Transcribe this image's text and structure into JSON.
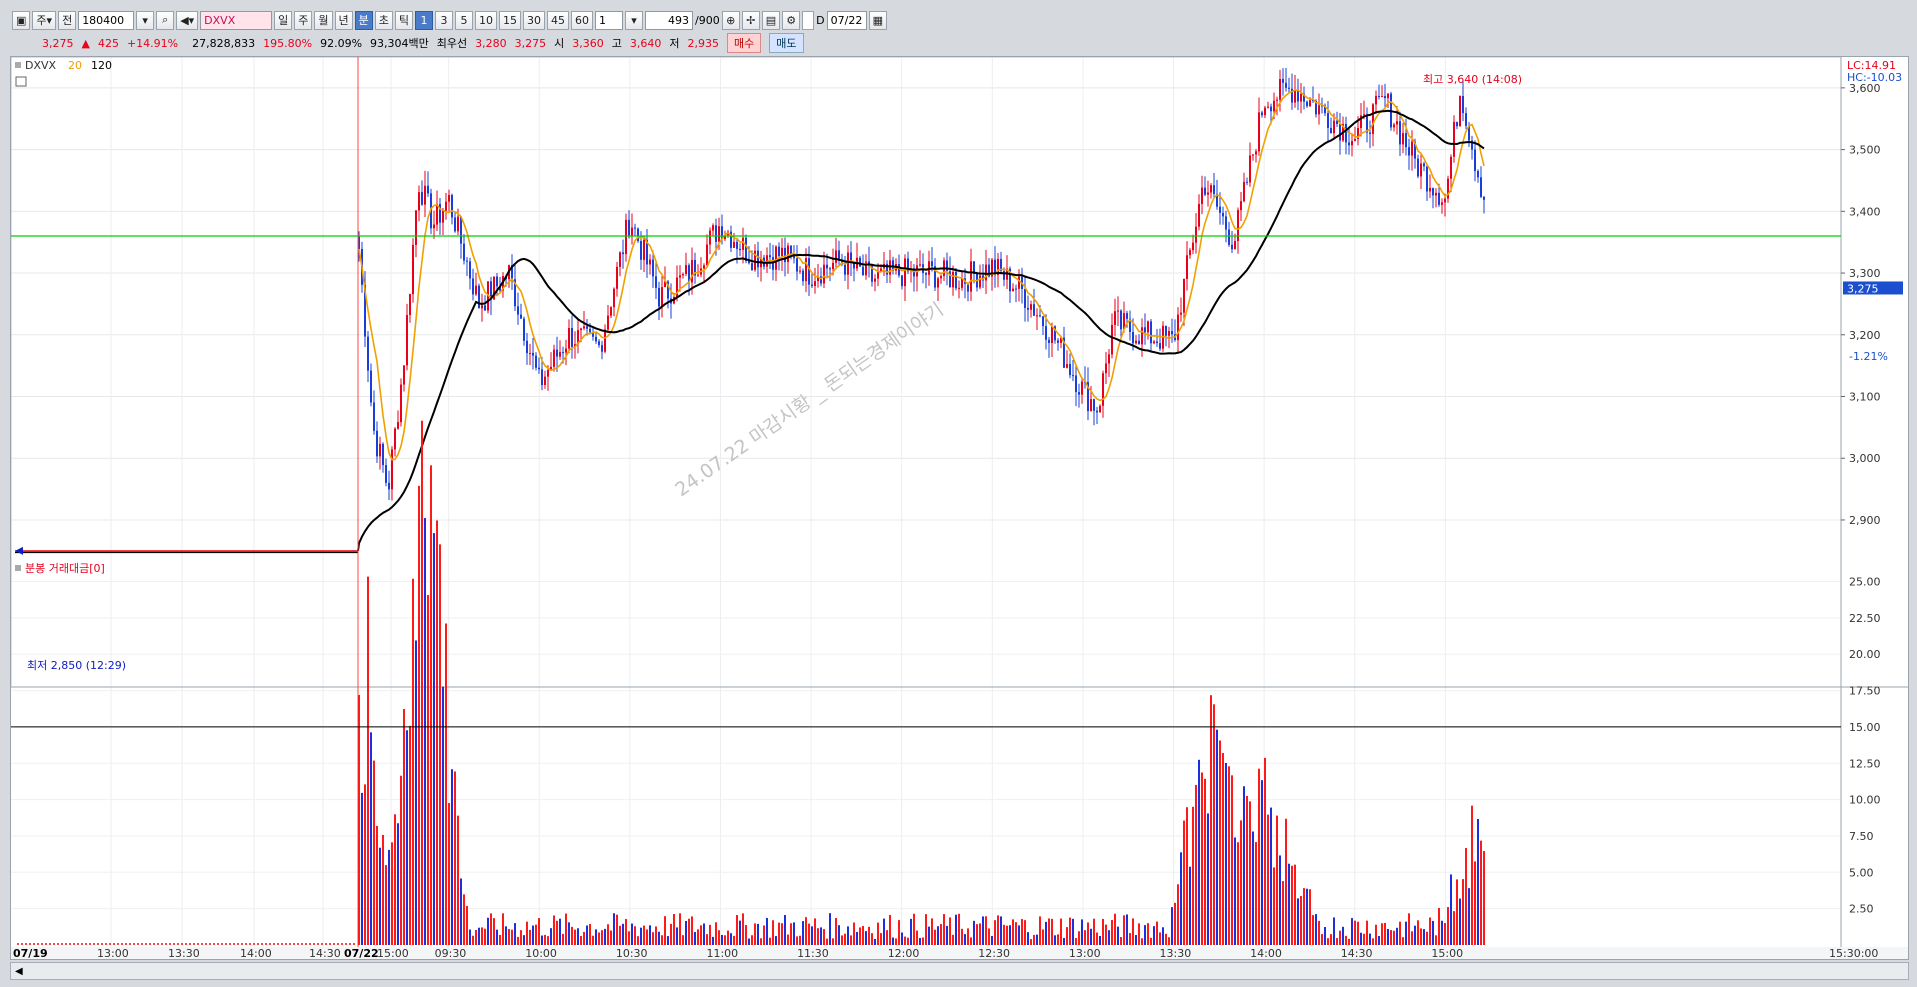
{
  "toolbar": {
    "market_type": "주",
    "view_mode": "전",
    "stock_code": "180400",
    "ticker": "DXVX",
    "periods": [
      "일",
      "주",
      "월",
      "년",
      "분",
      "초",
      "틱"
    ],
    "active_period": "분",
    "intervals": [
      "1",
      "3",
      "5",
      "10",
      "15",
      "30",
      "45",
      "60"
    ],
    "active_interval": "1",
    "interval_select": "1",
    "count": "493",
    "count_total": "/900",
    "checkbox_label": "D",
    "date": "07/22"
  },
  "infobar": {
    "price": "3,275",
    "change_arrow": "▲",
    "change": "425",
    "change_pct": "+14.91%",
    "volume": "27,828,833",
    "volume_ratio": "195.80%",
    "ratio2": "92.09%",
    "trade_value": "93,304백만",
    "best_label": "최우선",
    "ask": "3,280",
    "bid": "3,275",
    "open_label": "시",
    "open": "3,360",
    "high_label": "고",
    "high": "3,640",
    "low_label": "저",
    "low": "2,935",
    "buy_label": "매수",
    "sell_label": "매도"
  },
  "legend": {
    "ticker": "DXVX",
    "ma_short": "20",
    "ma_long": "120",
    "ma_short_color": "#f0a000",
    "ma_long_color": "#000000"
  },
  "right_axis": {
    "lc": "LC:14.91",
    "hc": "HC:-10.03",
    "current_price": "3,275",
    "current_pct": "-1.21%"
  },
  "annotations": {
    "high": "최고 3,640 (14:08)",
    "low": "최저 2,850 (12:29)",
    "watermark": "24.07.22 마감시황 _ 돈되는경제이야기"
  },
  "volume_panel": {
    "title": "분봉 거래대금[0]",
    "y_ticks": [
      "25.00",
      "22.50",
      "20.00",
      "17.50",
      "15.00",
      "12.50",
      "10.00",
      "7.50",
      "5.00",
      "2.50"
    ]
  },
  "time_axis": [
    "07/19",
    "13:00",
    "13:30",
    "14:00",
    "14:30",
    "15:00",
    "07/22",
    "09:30",
    "10:00",
    "10:30",
    "11:00",
    "11:30",
    "12:00",
    "12:30",
    "13:00",
    "13:30",
    "14:00",
    "14:30",
    "15:00",
    "15:30:00"
  ],
  "chart_data": {
    "type": "candlestick",
    "y_ticks": [
      "3,600",
      "3,500",
      "3,400",
      "3,300",
      "3,200",
      "3,100",
      "3,000",
      "2,900"
    ],
    "ylim": [
      2840,
      3650
    ],
    "reference_line": 3360,
    "previous_close_level": 2850,
    "high": {
      "value": 3640,
      "time": "14:08"
    },
    "low": {
      "value": 2850,
      "time": "12:29"
    },
    "close_series_approx": [
      {
        "t": "09:00",
        "v": 3360
      },
      {
        "t": "09:05",
        "v": 3050
      },
      {
        "t": "09:10",
        "v": 2950
      },
      {
        "t": "09:15",
        "v": 3150
      },
      {
        "t": "09:20",
        "v": 3450
      },
      {
        "t": "09:25",
        "v": 3380
      },
      {
        "t": "09:30",
        "v": 3420
      },
      {
        "t": "09:40",
        "v": 3250
      },
      {
        "t": "09:50",
        "v": 3300
      },
      {
        "t": "10:00",
        "v": 3120
      },
      {
        "t": "10:10",
        "v": 3200
      },
      {
        "t": "10:20",
        "v": 3180
      },
      {
        "t": "10:30",
        "v": 3390
      },
      {
        "t": "10:40",
        "v": 3260
      },
      {
        "t": "10:50",
        "v": 3300
      },
      {
        "t": "11:00",
        "v": 3380
      },
      {
        "t": "11:10",
        "v": 3330
      },
      {
        "t": "11:20",
        "v": 3330
      },
      {
        "t": "11:30",
        "v": 3300
      },
      {
        "t": "11:40",
        "v": 3320
      },
      {
        "t": "11:50",
        "v": 3290
      },
      {
        "t": "12:00",
        "v": 3300
      },
      {
        "t": "12:10",
        "v": 3300
      },
      {
        "t": "12:20",
        "v": 3290
      },
      {
        "t": "12:30",
        "v": 3310
      },
      {
        "t": "12:40",
        "v": 3270
      },
      {
        "t": "12:50",
        "v": 3200
      },
      {
        "t": "13:00",
        "v": 3110
      },
      {
        "t": "13:05",
        "v": 3080
      },
      {
        "t": "13:10",
        "v": 3220
      },
      {
        "t": "13:20",
        "v": 3200
      },
      {
        "t": "13:30",
        "v": 3190
      },
      {
        "t": "13:40",
        "v": 3450
      },
      {
        "t": "13:50",
        "v": 3350
      },
      {
        "t": "14:00",
        "v": 3580
      },
      {
        "t": "14:10",
        "v": 3600
      },
      {
        "t": "14:20",
        "v": 3560
      },
      {
        "t": "14:30",
        "v": 3520
      },
      {
        "t": "14:40",
        "v": 3580
      },
      {
        "t": "14:50",
        "v": 3480
      },
      {
        "t": "15:00",
        "v": 3420
      },
      {
        "t": "15:05",
        "v": 3600
      },
      {
        "t": "15:10",
        "v": 3480
      },
      {
        "t": "15:20",
        "v": 3275
      }
    ],
    "volume_spikes_approx": [
      {
        "t": "09:00",
        "v": 20.0
      },
      {
        "t": "09:22",
        "v": 25.0
      },
      {
        "t": "09:24",
        "v": 19.0
      },
      {
        "t": "13:42",
        "v": 15.5
      },
      {
        "t": "14:00",
        "v": 11.5
      },
      {
        "t": "15:10",
        "v": 8.5
      }
    ],
    "volume_reference_line": 15.0
  }
}
